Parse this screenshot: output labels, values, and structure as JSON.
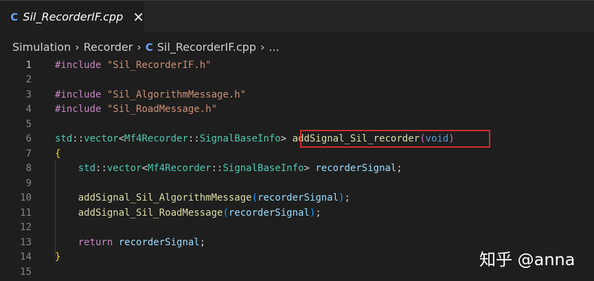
{
  "tab": {
    "icon": "C",
    "label": "Sil_RecorderIF.cpp",
    "close": "✕"
  },
  "breadcrumb": {
    "items": [
      "Simulation",
      "Recorder"
    ],
    "file": "Sil_RecorderIF.cpp",
    "more": "..."
  },
  "lines": [
    {
      "n": "1"
    },
    {
      "n": "2"
    },
    {
      "n": "3"
    },
    {
      "n": "4"
    },
    {
      "n": "5"
    },
    {
      "n": "6"
    },
    {
      "n": "7"
    },
    {
      "n": "8"
    },
    {
      "n": "9"
    },
    {
      "n": "10"
    },
    {
      "n": "11"
    },
    {
      "n": "12"
    },
    {
      "n": "13"
    },
    {
      "n": "14"
    },
    {
      "n": "15"
    }
  ],
  "code": {
    "l1": {
      "kw": "#include",
      "str": "\"Sil_RecorderIF.h\""
    },
    "l3": {
      "kw": "#include",
      "str": "\"Sil_AlgorithmMessage.h\""
    },
    "l4": {
      "kw": "#include",
      "str": "\"Sil_RoadMessage.h\""
    },
    "l6": {
      "ns1": "std",
      "sep1": "::",
      "type1": "vector",
      "lt": "<",
      "ns2": "Mf4Recorder",
      "sep2": "::",
      "type2": "SignalBaseInfo",
      "gt": ">",
      "fn": "addSignal_Sil_recorder",
      "po": "(",
      "arg": "void",
      "pc": ")"
    },
    "l7": {
      "brace": "{"
    },
    "l8": {
      "ns1": "std",
      "sep1": "::",
      "type1": "vector",
      "lt": "<",
      "ns2": "Mf4Recorder",
      "sep2": "::",
      "type2": "SignalBaseInfo",
      "gt": ">",
      "var": "recorderSignal",
      "semi": ";"
    },
    "l10": {
      "fn": "addSignal_Sil_AlgorithmMessage",
      "po": "(",
      "var": "recorderSignal",
      "pc": ")",
      "semi": ";"
    },
    "l11": {
      "fn": "addSignal_Sil_RoadMessage",
      "po": "(",
      "var": "recorderSignal",
      "pc": ")",
      "semi": ";"
    },
    "l13": {
      "kw": "return",
      "var": "recorderSignal",
      "semi": ";"
    },
    "l14": {
      "brace": "}"
    }
  },
  "watermark": "知乎 @anna",
  "colors": {
    "background": "#1e1e1e",
    "highlight_box": "#d42b2b",
    "file_icon": "#6aa7ff"
  }
}
